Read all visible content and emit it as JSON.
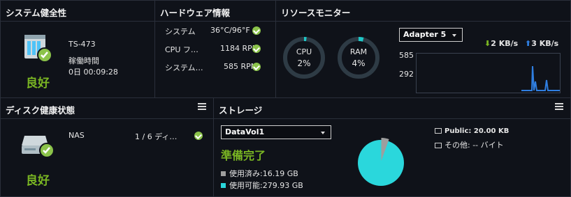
{
  "system_health": {
    "title": "システム健全性",
    "model": "TS-473",
    "uptime_label": "稼働時間",
    "uptime_value": "0日 00:09:28",
    "status": "良好",
    "icon": "nas-icon"
  },
  "hardware": {
    "title": "ハードウェア情報",
    "rows": [
      {
        "label": "システム",
        "value": "36°C/96°F"
      },
      {
        "label": "CPU フ…",
        "value": "1184 RPM"
      },
      {
        "label": "システム…",
        "value": "585 RPM"
      }
    ]
  },
  "resource_monitor": {
    "title": "リソースモニター",
    "cpu_label": "CPU",
    "cpu_value": "2%",
    "cpu_percent": 2,
    "ram_label": "RAM",
    "ram_value": "4%",
    "ram_percent": 4,
    "adapter": "Adapter 5",
    "download": "2 KB/s",
    "upload": "3 KB/s",
    "y_top": "585",
    "y_mid": "292"
  },
  "disk_health": {
    "title": "ディスク健康状態",
    "name": "NAS",
    "disks": "1 / 6 ディ…",
    "status": "良好",
    "icon": "disk-icon"
  },
  "storage": {
    "title": "ストレージ",
    "volume": "DataVol1",
    "status": "準備完了",
    "used": "使用済み:16.19 GB",
    "available": "使用可能:279.93 GB",
    "public": "Public: 20.00 KB",
    "other": "その他: -- バイト",
    "used_fraction": 0.0547
  },
  "colors": {
    "accent": "#7ab623",
    "ring": "#1ec8c8",
    "ring_track": "#2e3b45",
    "pie_free": "#2ad7dc",
    "pie_used": "#9e9e9e",
    "chart_line": "#2f7ee0"
  }
}
